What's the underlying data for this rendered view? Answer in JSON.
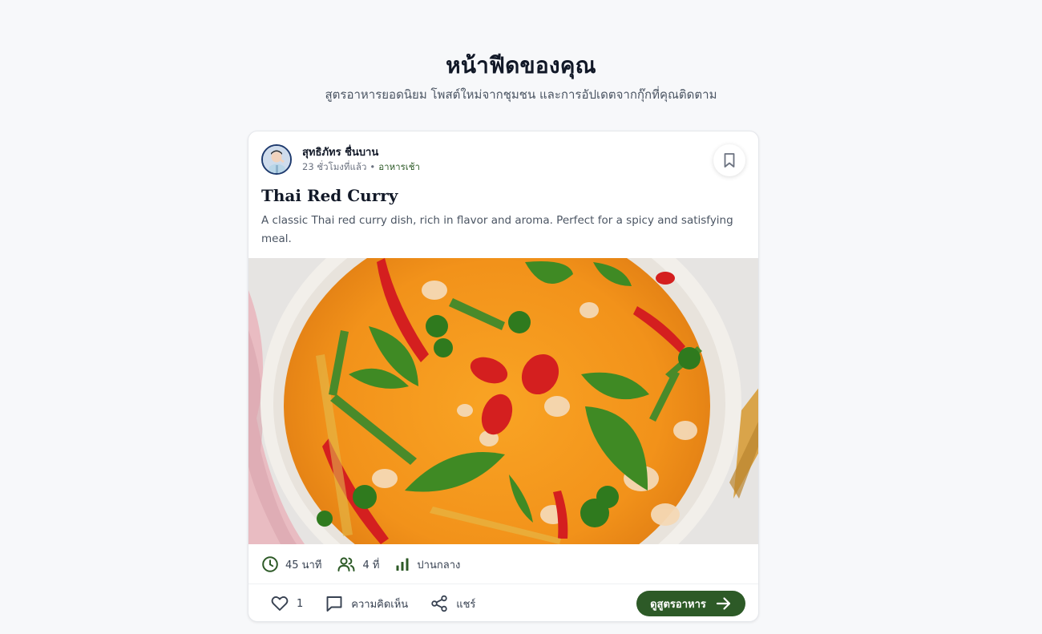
{
  "header": {
    "title": "หน้าฟีดของคุณ",
    "subtitle": "สูตรอาหารยอดนิยม โพสต์ใหม่จากชุมชน และการอัปเดตจากกุ๊กที่คุณติดตาม"
  },
  "post": {
    "author": {
      "name": "สุทธิภัทร ชื่นบาน",
      "time_ago": "23 ชั่วโมงที่แล้ว",
      "separator": "•",
      "category": "อาหารเช้า"
    },
    "title": "Thai Red Curry",
    "description": "A classic Thai red curry dish, rich in flavor and aroma. Perfect for a spicy and satisfying meal.",
    "stats": {
      "time": "45 นาที",
      "servings": "4 ที่",
      "difficulty": "ปานกลาง"
    },
    "actions": {
      "like_count": "1",
      "comment_label": "ความคิดเห็น",
      "share_label": "แชร์",
      "view_recipe_label": "ดูสูตรอาหาร"
    }
  },
  "colors": {
    "accent": "#2d5a27",
    "background": "#f7f8fa",
    "card": "#ffffff",
    "title": "#111827",
    "muted": "#6b7280"
  },
  "icons": {
    "bookmark": "bookmark-icon",
    "time": "clock-icon",
    "servings": "users-icon",
    "difficulty": "bar-chart-icon",
    "like": "heart-icon",
    "comment": "comment-icon",
    "share": "share-icon",
    "arrow": "arrow-right-icon"
  }
}
